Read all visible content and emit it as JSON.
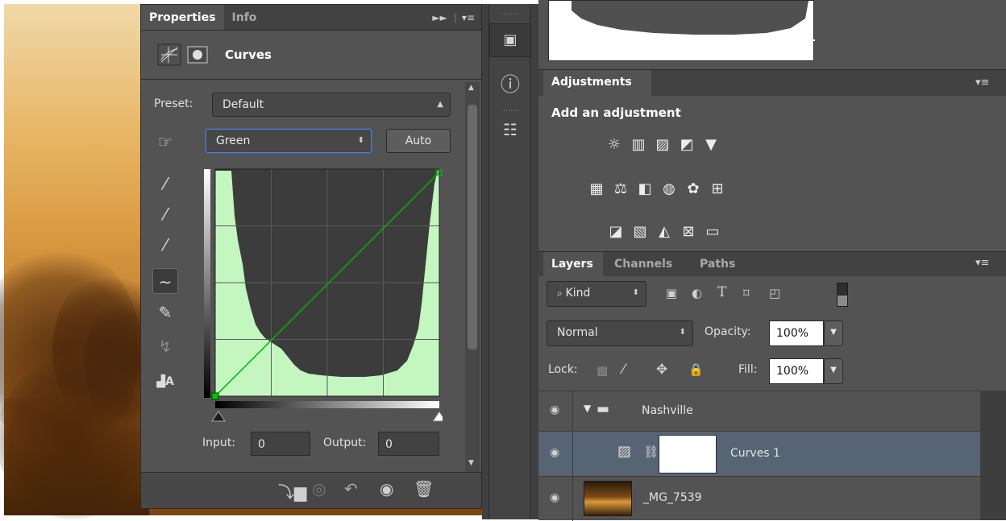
{
  "properties_panel": {
    "tabs": [
      "Properties",
      "Info"
    ],
    "title": "Curves",
    "preset_label": "Preset:",
    "preset_value": "Default",
    "channel_value": "Green",
    "auto_label": "Auto",
    "input_label": "Input:",
    "input_value": "0",
    "output_label": "Output:",
    "output_value": "0"
  },
  "adjustments_panel": {
    "tab": "Adjustments",
    "heading": "Add an adjustment"
  },
  "layers_panel": {
    "tabs": [
      "Layers",
      "Channels",
      "Paths"
    ],
    "kind_value": "Kind",
    "blend_mode": "Normal",
    "opacity_label": "Opacity:",
    "opacity_value": "100%",
    "lock_label": "Lock:",
    "fill_label": "Fill:",
    "fill_value": "100%",
    "layers": [
      {
        "name": "Nashville",
        "type": "group"
      },
      {
        "name": "Curves 1",
        "type": "adjustment",
        "selected": true
      },
      {
        "name": "_MG_7539",
        "type": "image"
      }
    ]
  },
  "colors": {
    "panel_bg": "#535353",
    "curve_line": "#00b400",
    "histogram_fill": "#c4f6c0",
    "selected_layer": "#566474"
  }
}
